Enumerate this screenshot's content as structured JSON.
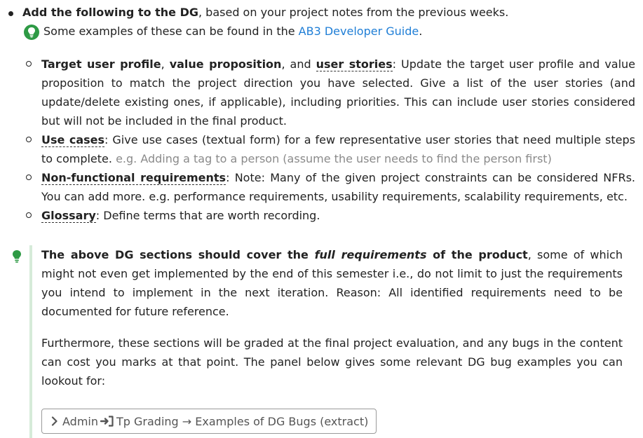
{
  "main_bullet": {
    "bold": "Add the following to the DG",
    "rest": ", based on your project notes from the previous weeks."
  },
  "tip_line": {
    "icon": "lightbulb-icon",
    "text": "Some examples of these can be found in the",
    "link": "AB3 Developer Guide",
    "end": "."
  },
  "items": [
    {
      "t1": "Target user profile",
      "s1": ", ",
      "t2": "value proposition",
      "s2": ", and ",
      "t3": "user stories",
      "body": ": Update the target user profile and value proposition to match the project direction you have selected. Give a list of the user stories (and update/delete existing ones, if applicable), including priorities. This can include user stories considered but will not be included in the final product."
    },
    {
      "term": "Use cases",
      "body": ": Give use cases (textual form) for a few representative user stories that need multiple steps to complete. ",
      "example": "e.g. Adding a tag to a person (assume the user needs to find the person first)"
    },
    {
      "term": "Non-functional requirements",
      "body": ": Note: Many of the given project constraints can be considered NFRs. You can add more. e.g. performance requirements, usability requirements, scalability requirements, etc."
    },
    {
      "term": "Glossary",
      "body": ": Define terms that are worth recording."
    }
  ],
  "tip_box": {
    "icon": "lightbulb-icon",
    "p1_bold_a": "The above DG sections should cover the ",
    "p1_bold_em": "full requirements",
    "p1_bold_b": " of the product",
    "p1_rest": ", some of which might not even get implemented by the end of this semester i.e., do not limit to just the requirements you intend to implement in the next iteration. Reason: All identified requirements need to be documented for future reference.",
    "p2": "Furthermore, these sections will be graded at the final project evaluation, and any bugs in the content can cost you marks at that point. The panel below gives some relevant DG bug examples you can lookout for:"
  },
  "panel": {
    "part1": "Admin",
    "part2": "Tp Grading → Examples of DG Bugs (extract)"
  },
  "colors": {
    "link": "#1f7ed6",
    "tip_green": "#2e9a45",
    "tip_bar": "#d6ebd9",
    "example_grey": "#8a8a8a"
  }
}
